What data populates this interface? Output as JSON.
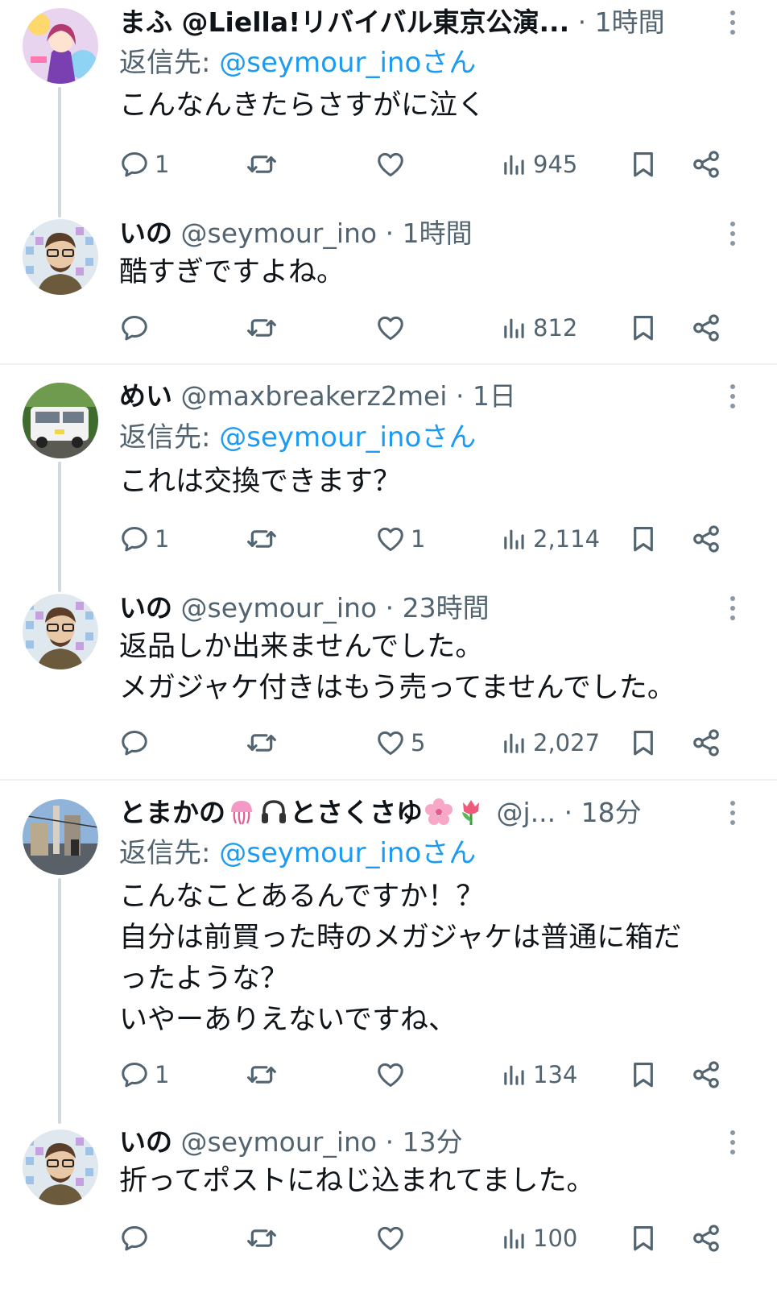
{
  "tweets": [
    {
      "name": "まふ @Liella!リバイバル東京公演...",
      "handle": "",
      "time": "· 1時間",
      "replying_prefix": "返信先: ",
      "replying_to": "@seymour_inoさん",
      "lines": [
        "こんなんきたらさすがに泣く"
      ],
      "replies": "1",
      "retweets": "",
      "likes": "",
      "views": "945"
    },
    {
      "name": "いの",
      "handle": "@seymour_ino",
      "time": "· 1時間",
      "lines": [
        "酷すぎですよね。"
      ],
      "replies": "",
      "retweets": "",
      "likes": "",
      "views": "812"
    },
    {
      "name": "めい",
      "handle": "@maxbreakerz2mei",
      "time": "· 1日",
      "replying_prefix": "返信先: ",
      "replying_to": "@seymour_inoさん",
      "lines": [
        "これは交換できます？"
      ],
      "replies": "1",
      "retweets": "",
      "likes": "1",
      "views": "2,114"
    },
    {
      "name": "いの",
      "handle": "@seymour_ino",
      "time": "· 23時間",
      "lines": [
        "返品しか出来ませんでした。",
        "メガジャケ付きはもう売ってませんでした。"
      ],
      "replies": "",
      "retweets": "",
      "likes": "5",
      "views": "2,027"
    },
    {
      "name_a": "とまかの",
      "name_b": "とさくさゆ",
      "handle": "@j...",
      "time": "· 18分",
      "replying_prefix": "返信先: ",
      "replying_to": "@seymour_inoさん",
      "lines": [
        "こんなことあるんですか！？",
        "自分は前買った時のメガジャケは普通に箱だ",
        "ったような？",
        "いやーありえないですね、"
      ],
      "replies": "1",
      "retweets": "",
      "likes": "",
      "views": "134"
    },
    {
      "name": "いの",
      "handle": "@seymour_ino",
      "time": "· 13分",
      "lines": [
        "折ってポストにねじ込まれてました。"
      ],
      "replies": "",
      "retweets": "",
      "likes": "",
      "views": "100"
    }
  ],
  "icons": {
    "reply": "reply-icon",
    "retweet": "retweet-icon",
    "like": "heart-icon",
    "views": "views-icon",
    "bookmark": "bookmark-icon",
    "share": "share-icon",
    "more": "more-icon"
  },
  "colors": {
    "text": "#0f1419",
    "secondary": "#536471",
    "link": "#1d9bf0",
    "divider": "#eff3f4",
    "thread": "#cfd9de"
  }
}
